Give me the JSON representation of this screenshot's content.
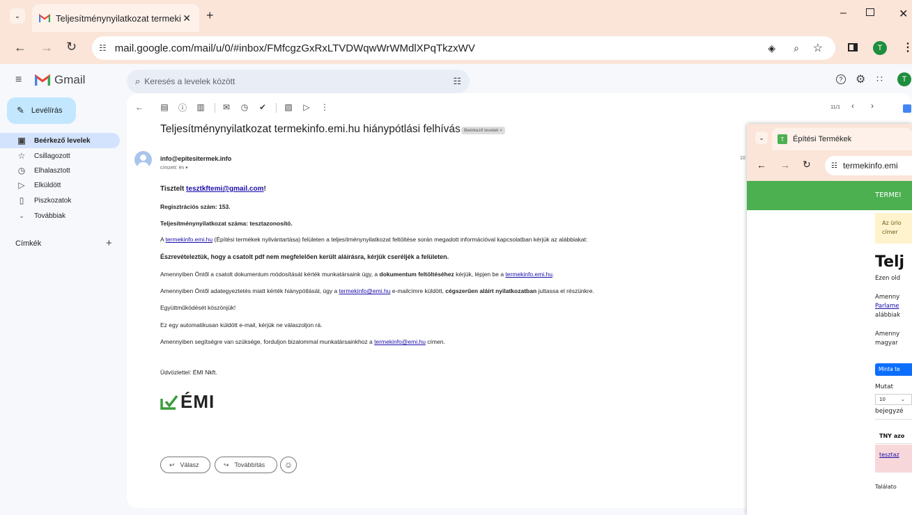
{
  "browser": {
    "tab_title": "Teljesítménynyilatkozat termeki",
    "tab_favicon": "gmail-m-icon",
    "url": "mail.google.com/mail/u/0/#inbox/FMfcgzGxRxLTVDWqwWrWMdlXPqTkzxWV",
    "profile_initial": "T",
    "colors": {
      "frame": "#fbe4d8",
      "tab": "#fdf1ea",
      "profile": "#1e8e3e"
    }
  },
  "gmail": {
    "brand": "Gmail",
    "search_placeholder": "Keresés a levelek között",
    "compose_label": "Levélírás",
    "nav": [
      {
        "label": "Beérkező levelek",
        "icon": "inbox-icon",
        "active": true
      },
      {
        "label": "Csillagozott",
        "icon": "star-icon"
      },
      {
        "label": "Elhalasztott",
        "icon": "clock-icon"
      },
      {
        "label": "Elküldött",
        "icon": "send-icon"
      },
      {
        "label": "Piszkozatok",
        "icon": "draft-icon"
      },
      {
        "label": "Továbbiak",
        "icon": "chevron-down-icon"
      }
    ],
    "labels_title": "Címkék",
    "pager": "11/1",
    "profile_initial": "T"
  },
  "email": {
    "subject": "Teljesítménynyilatkozat termekinfo.emi.hu hiánypótlási felhívás",
    "label_chip": "Beérkező levelek ×",
    "sender": "info@epitesitermek.info",
    "recipient": "címzett: én ▾",
    "time": "10",
    "greeting_prefix": "Tisztelt ",
    "greeting_email": "tesztkftemi@gmail.com",
    "greeting_suffix": "!",
    "reg_number": "Regisztrációs szám: 153.",
    "tny_number": "Teljesítménynyilatkozat száma: tesztazonosító.",
    "p1_pre": "A ",
    "p1_link": "termekinfo.emi.hu",
    "p1_post": " (Építési termékek nyilvántartása) felületen a teljesítménynyilatkozat feltöltése során megadott információval kapcsolatban kérjük az alábbiakat:",
    "p2": "Észrevételeztük, hogy a csatolt pdf nem megfelelően került aláírásra, kérjük cseréljék a felületen.",
    "p3_pre": "Amennyiben Öntől a csatolt dokumentum módosítását kérték munkatársaink úgy, a ",
    "p3_bold": "dokumentum feltöltéséhez",
    "p3_mid": " kérjük, lépjen be a ",
    "p3_link": "termekinfo.emi.hu",
    "p3_post": ".",
    "p4_pre": "Amennyiben Öntől adategyeztetés miatt kérték hiánypótlását, úgy a ",
    "p4_link": "termekinfo@emi.hu",
    "p4_mid": " e-mailcímre küldött, ",
    "p4_bold": "cégszerűen aláírt nyilatkozatban",
    "p4_post": " juttassa el részünkre.",
    "p5": "Együttműködését köszönjük!",
    "p6": "Ez egy automatikusan küldött e-mail, kérjük ne válaszoljon rá.",
    "p7_pre": "Amennyiben segítségre van szüksége, forduljon bizalommal munkatársainkhoz a ",
    "p7_link": "termekinfo@emi.hu",
    "p7_post": " címen.",
    "signoff": "Üdvözlettel: ÉMI Nkft.",
    "logo_text": "ÉMI",
    "reply_label": "Válasz",
    "forward_label": "Továbbítás"
  },
  "popup": {
    "tab_title": "Építési Termékek",
    "url": "termekinfo.emi",
    "banner": "TERMEI",
    "notice_line1": "Az ürlo",
    "notice_line2": "címer",
    "heading": "Telj",
    "line_intro": "Ezen old",
    "line_a1": "Amenny",
    "line_a2": "Parlame",
    "line_a3": "alábbiak",
    "line_b1": "Amenny",
    "line_b2": "magyar",
    "button": "Minta te",
    "show_label": "Mutat",
    "page_size": "10",
    "entries_label": "bejegyzé",
    "table_header": "TNY azo",
    "table_row": "tesztaz",
    "results_label": "Találato",
    "colors": {
      "banner": "#4caf50",
      "notice": "#fff3cd",
      "button": "#0d6efd",
      "row": "#f8d7da"
    }
  }
}
